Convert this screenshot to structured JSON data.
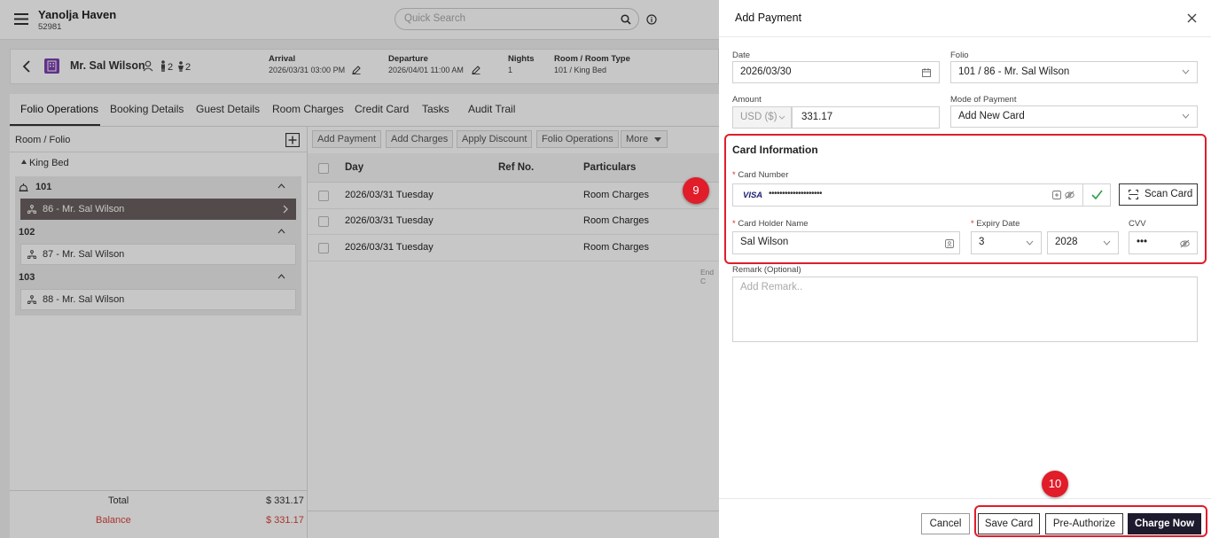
{
  "app": {
    "hotel_name": "Yanolja Haven",
    "hotel_code": "52981",
    "search_placeholder": "Quick Search"
  },
  "guest": {
    "name": "Mr. Sal Wilson",
    "adults": "2",
    "children": "2",
    "arrival_label": "Arrival",
    "arrival_value": "2026/03/31 03:00 PM",
    "departure_label": "Departure",
    "departure_value": "2026/04/01 11:00 AM",
    "nights_label": "Nights",
    "nights_value": "1",
    "room_label": "Room / Room Type",
    "room_value": "101 / King Bed"
  },
  "tabs": [
    "Folio Operations",
    "Booking Details",
    "Guest Details",
    "Room Charges",
    "Credit Card",
    "Tasks",
    "Audit Trail"
  ],
  "left_panel": {
    "header": "Room / Folio",
    "room_type": "King Bed",
    "rooms": [
      {
        "number": "101",
        "folio": "86 - Mr. Sal Wilson"
      },
      {
        "number": "102",
        "folio": "87 - Mr. Sal Wilson"
      },
      {
        "number": "103",
        "folio": "88 - Mr. Sal Wilson"
      }
    ],
    "total_label": "Total",
    "total_value": "$ 331.17",
    "balance_label": "Balance",
    "balance_value": "$ 331.17"
  },
  "toolbar": {
    "add_payment": "Add Payment",
    "add_charges": "Add Charges",
    "apply_discount": "Apply Discount",
    "folio_operations": "Folio Operations",
    "more": "More"
  },
  "table": {
    "headers": {
      "day": "Day",
      "ref": "Ref No.",
      "particulars": "Particulars"
    },
    "rows": [
      {
        "day": "2026/03/31 Tuesday",
        "particulars": "Room Charges"
      },
      {
        "day": "2026/03/31 Tuesday",
        "particulars": "Room Charges"
      },
      {
        "day": "2026/03/31 Tuesday",
        "particulars": "Room Charges"
      }
    ],
    "end_text": "End C"
  },
  "drawer": {
    "title": "Add Payment",
    "date_label": "Date",
    "date_value": "2026/03/30",
    "folio_label": "Folio",
    "folio_value": "101 / 86 - Mr. Sal Wilson",
    "amount_label": "Amount",
    "currency": "USD ($)",
    "amount_value": "331.17",
    "mode_label": "Mode of Payment",
    "mode_value": "Add New Card",
    "card_section_title": "Card Information",
    "card_number_label": "Card Number",
    "card_brand": "VISA",
    "card_number_masked": "••••••••••••••••••••",
    "scan_card": "Scan Card",
    "holder_label": "Card Holder Name",
    "holder_value": "Sal Wilson",
    "expiry_label": "Expiry Date",
    "expiry_month": "3",
    "expiry_year": "2028",
    "cvv_label": "CVV",
    "cvv_masked": "•••",
    "remark_label": "Remark (Optional)",
    "remark_placeholder": "Add Remark..",
    "cancel": "Cancel",
    "save_card": "Save Card",
    "pre_authorize": "Pre-Authorize",
    "charge_now": "Charge Now"
  },
  "annotations": {
    "step_a": "9",
    "step_b": "10"
  },
  "colors": {
    "annotation_red": "#e11d2a",
    "primary_dark": "#1e1b2e",
    "selected_folio": "#6b6161",
    "balance_red": "#d9433b"
  }
}
